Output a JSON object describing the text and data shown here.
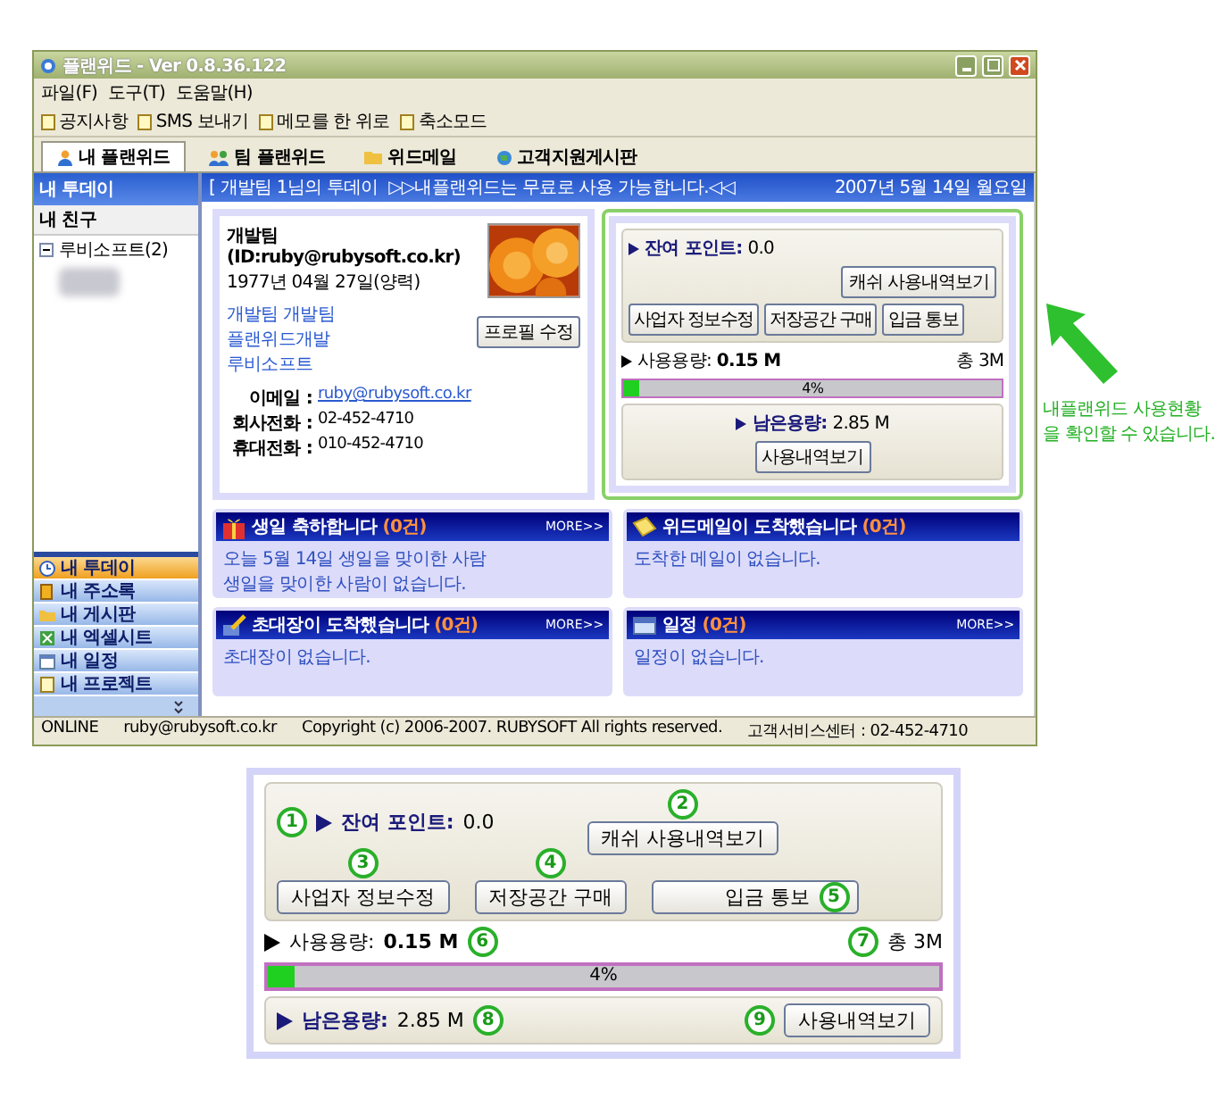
{
  "window": {
    "title": "플랜위드 - Ver 0.8.36.122"
  },
  "menu": [
    "파일(F)",
    "도구(T)",
    "도움말(H)"
  ],
  "toolbar": [
    {
      "label": "공지사항"
    },
    {
      "label": "SMS 보내기"
    },
    {
      "label": "메모를 한 위로"
    },
    {
      "label": "축소모드"
    }
  ],
  "tabs": [
    {
      "label": "내 플랜위드",
      "selected": true,
      "kind": "person"
    },
    {
      "label": "팀 플랜위드",
      "selected": false,
      "kind": "group"
    },
    {
      "label": "위드메일",
      "selected": false,
      "kind": "mail"
    },
    {
      "label": "고객지원게시판",
      "selected": false,
      "kind": "support"
    }
  ],
  "sidebar": {
    "title": "내 투데이",
    "section": "내 친구",
    "tree": [
      {
        "label": "루비소프트(2)",
        "expanded": true
      }
    ],
    "nav": [
      {
        "label": "내 투데이",
        "selected": true,
        "kind": "clock"
      },
      {
        "label": "내 주소록",
        "selected": false,
        "kind": "book"
      },
      {
        "label": "내 게시판",
        "selected": false,
        "kind": "folder"
      },
      {
        "label": "내 엑셀시트",
        "selected": false,
        "kind": "sheet"
      },
      {
        "label": "내 일정",
        "selected": false,
        "kind": "calendar"
      },
      {
        "label": "내 프로젝트",
        "selected": false,
        "kind": "document"
      }
    ]
  },
  "header": {
    "text": "[ 개발팀 1님의 투데이",
    "notice": "▷▷내플랜위드는 무료로 사용 가능합니다.◁◁",
    "date": "2007년 5월 14일 월요일"
  },
  "profile": {
    "name": "개발팀 (ID:ruby@rubysoft.co.kr)",
    "birthday": "1977년 04월 27일(양력)",
    "groups": [
      "개발팀  개발팀",
      "플랜위드개발",
      "루비소프트"
    ],
    "contacts": [
      {
        "label": "이메일 :",
        "value": "ruby@rubysoft.co.kr",
        "kind": "link"
      },
      {
        "label": "회사전화 :",
        "value": "02-452-4710",
        "kind": "text"
      },
      {
        "label": "휴대전화 :",
        "value": "010-452-4710",
        "kind": "text"
      }
    ],
    "edit_button": "프로필 수정"
  },
  "usage": {
    "points_label": "잔여 포인트:",
    "points": "0.0",
    "cash_button": "캐쉬 사용내역보기",
    "buttons": [
      "사업자 정보수정",
      "저장공간 구매",
      "입금 통보"
    ],
    "used_label": "사용용량:",
    "used": "0.15 M",
    "total": "총 3M",
    "level": 0.04,
    "percent": "4%",
    "remaining_label": "남은용량:",
    "remaining": "2.85 M",
    "history_button": "사용내역보기"
  },
  "cards": [
    {
      "kind": "birthday",
      "title": "생일 축하합니다",
      "count": "(0건)",
      "more": "MORE>>",
      "lines": [
        "오늘 5월 14일 생일을 맞이한 사람",
        "생일을 맞이한 사람이 없습니다."
      ]
    },
    {
      "kind": "mail",
      "title": "위드메일이 도착했습니다",
      "count": "(0건)",
      "lines": [
        "도착한 메일이 없습니다."
      ]
    },
    {
      "kind": "invite",
      "title": "초대장이 도착했습니다",
      "count": "(0건)",
      "more": "MORE>>",
      "lines": [
        "초대장이 없습니다."
      ]
    },
    {
      "kind": "schedule",
      "title": "일정",
      "count": "(0건)",
      "more": "MORE>>",
      "lines": [
        "일정이 없습니다."
      ]
    }
  ],
  "status_bar": [
    "ONLINE",
    "ruby@rubysoft.co.kr",
    "Copyright (c) 2006-2007. RUBYSOFT All rights reserved.",
    "고객서비스센터 : 02-452-4710"
  ],
  "callout": "내플랜위드 사용현황\n을 확인할 수 있습니다.",
  "detail": {
    "points_label": "잔여 포인트:",
    "points": "0.0",
    "cash_button": "캐쉬 사용내역보기",
    "buttons": [
      "사업자 정보수정",
      "저장공간 구매",
      "입금 통보"
    ],
    "used_label": "사용용량:",
    "used": "0.15 M",
    "total": "총 3M",
    "level": 0.04,
    "percent": "4%",
    "remaining_label": "남은용량:",
    "remaining": "2.85 M",
    "history_button": "사용내역보기",
    "markers": [
      "1",
      "2",
      "3",
      "4",
      "5",
      "6",
      "7",
      "8",
      "9"
    ]
  }
}
